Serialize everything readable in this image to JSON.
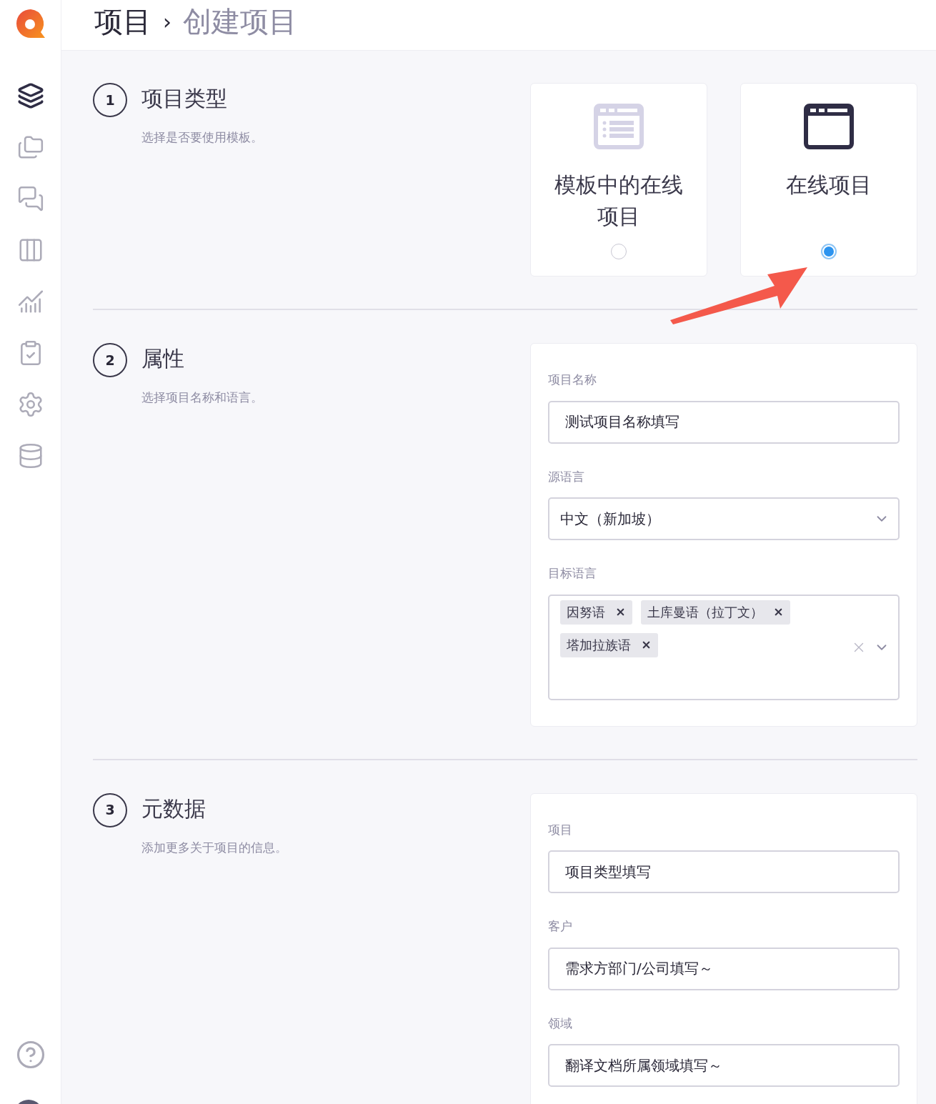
{
  "breadcrumb": {
    "parent": "项目",
    "separator": "›",
    "current": "创建项目"
  },
  "sidebar": {
    "items": [
      {
        "kind": "layers",
        "selected": true
      },
      {
        "kind": "folders",
        "selected": false
      },
      {
        "kind": "chat",
        "selected": false
      },
      {
        "kind": "columns",
        "selected": false
      },
      {
        "kind": "chart",
        "selected": false
      },
      {
        "kind": "clipboard",
        "selected": false
      },
      {
        "kind": "settings",
        "selected": false
      },
      {
        "kind": "database",
        "selected": false
      }
    ]
  },
  "sections": [
    {
      "kind": "choice",
      "number": "1",
      "title": "项目类型",
      "subtitle": "选择是否要使用模板。",
      "options": [
        {
          "kind": "template",
          "label": "模板中的在线项目",
          "selected": false
        },
        {
          "kind": "window",
          "label": "在线项目",
          "selected": true
        }
      ]
    },
    {
      "kind": "form",
      "number": "2",
      "title": "属性",
      "subtitle": "选择项目名称和语言。",
      "fields": [
        {
          "kind": "text",
          "label": "项目名称",
          "value": "测试项目名称填写"
        },
        {
          "kind": "select",
          "label": "源语言",
          "value": "中文（新加坡）"
        },
        {
          "kind": "multiselect",
          "label": "目标语言",
          "tags": [
            "因努语",
            "土库曼语（拉丁文）",
            "塔加拉族语"
          ]
        }
      ]
    },
    {
      "kind": "form",
      "number": "3",
      "title": "元数据",
      "subtitle": "添加更多关于项目的信息。",
      "fields": [
        {
          "kind": "text",
          "label": "项目",
          "value": "项目类型填写"
        },
        {
          "kind": "text",
          "label": "客户",
          "value": "需求方部门/公司填写～"
        },
        {
          "kind": "text",
          "label": "领域",
          "value": "翻译文档所属领域填写～"
        }
      ]
    }
  ]
}
